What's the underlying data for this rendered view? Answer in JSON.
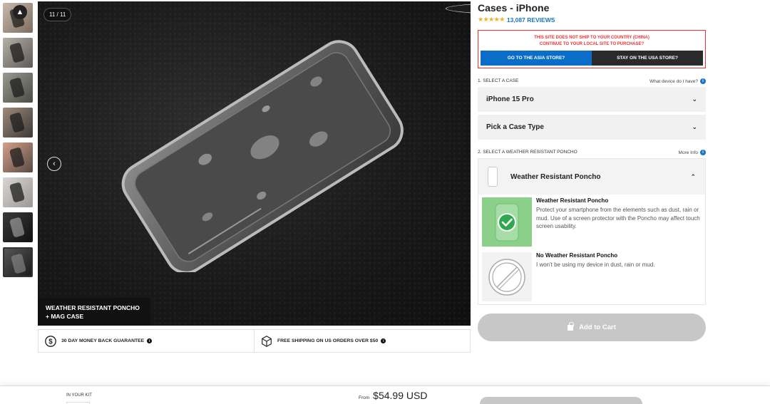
{
  "gallery": {
    "counter": "11 / 11",
    "caption_line1": "WEATHER RESISTANT PONCHO",
    "caption_line2": "+ MAG CASE",
    "thumbnail_count": 8
  },
  "guarantees": {
    "money_back": "30 DAY MONEY BACK GUARANTEE",
    "free_shipping": "FREE SHIPPING ON US ORDERS OVER $50"
  },
  "product": {
    "title": "Cases - iPhone",
    "stars": "★★★★★",
    "reviews": "13,087 REVIEWS"
  },
  "shipping_notice": {
    "line1": "THIS SITE DOES NOT SHIP TO YOUR COUNTRY (CHINA)",
    "line2": "CONTINUE TO YOUR LOCAL SITE TO PURCHASE?",
    "asia_button": "GO TO THE ASIA STORE?",
    "usa_button": "STAY ON THE USA STORE?"
  },
  "step1": {
    "label": "1. SELECT A CASE",
    "help_link": "What device do I have?",
    "device_value": "iPhone 15 Pro",
    "case_type_value": "Pick a Case Type"
  },
  "step2": {
    "label": "2. SELECT A WEATHER RESISTANT PONCHO",
    "more_info": "More Info",
    "selected": "Weather Resistant Poncho",
    "options": [
      {
        "title": "Weather Resistant Poncho",
        "description": "Protect your smartphone from the elements such as dust, rain or mud. Use of a screen protector with the Poncho may affect touch screen usability."
      },
      {
        "title": "No Weather Resistant Poncho",
        "description": "I won't be using my device in dust, rain or mud."
      }
    ]
  },
  "cart": {
    "label": "Add to Cart"
  },
  "sticky_bar": {
    "kit_label": "IN YOUR KIT",
    "from": "From",
    "price": "$54.99 USD"
  },
  "colors": {
    "accent_blue": "#0a6ec9",
    "warning_red": "#e33333",
    "selected_green": "#8ad08a",
    "disabled_button": "#c7c7c7"
  }
}
